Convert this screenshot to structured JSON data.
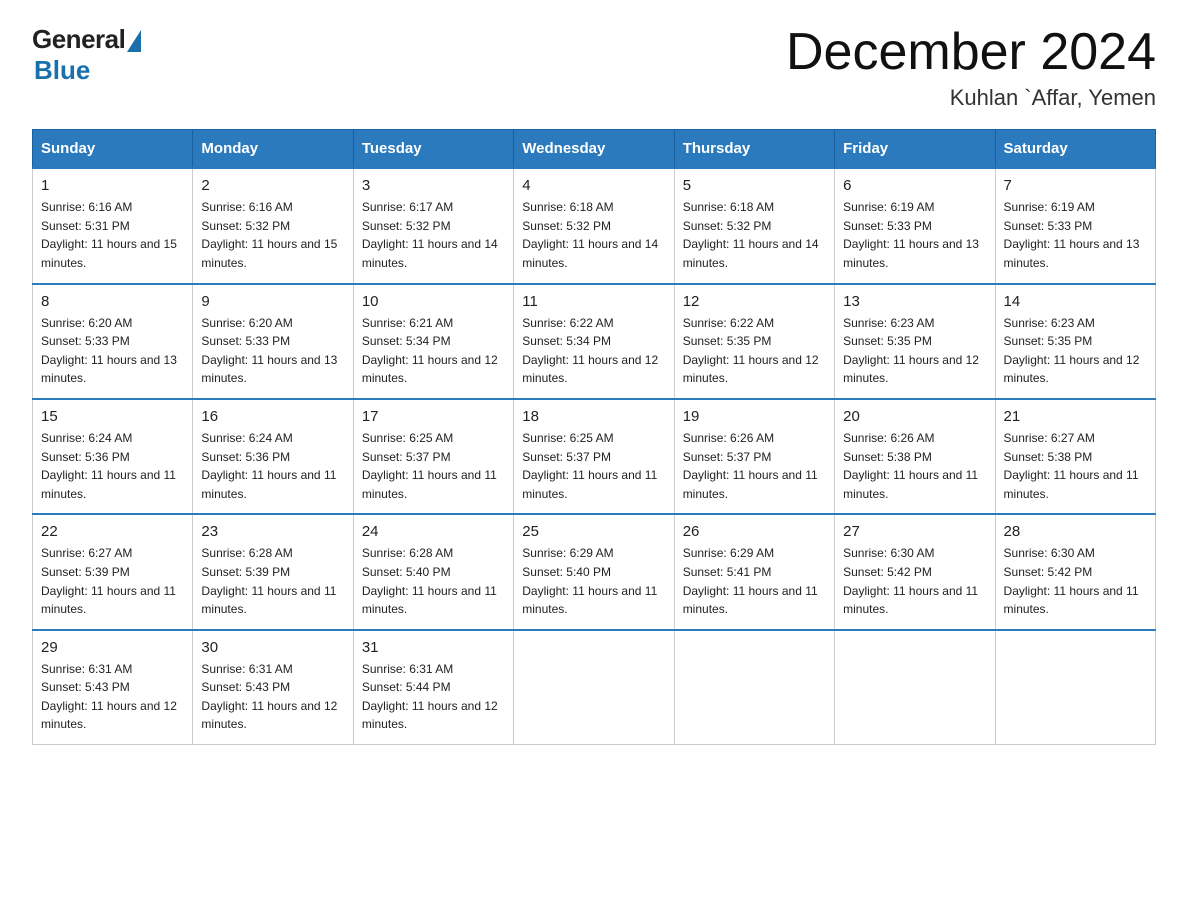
{
  "header": {
    "logo_general": "General",
    "logo_blue": "Blue",
    "month_title": "December 2024",
    "location": "Kuhlan `Affar, Yemen"
  },
  "weekdays": [
    "Sunday",
    "Monday",
    "Tuesday",
    "Wednesday",
    "Thursday",
    "Friday",
    "Saturday"
  ],
  "weeks": [
    [
      {
        "day": "1",
        "sunrise": "6:16 AM",
        "sunset": "5:31 PM",
        "daylight": "11 hours and 15 minutes."
      },
      {
        "day": "2",
        "sunrise": "6:16 AM",
        "sunset": "5:32 PM",
        "daylight": "11 hours and 15 minutes."
      },
      {
        "day": "3",
        "sunrise": "6:17 AM",
        "sunset": "5:32 PM",
        "daylight": "11 hours and 14 minutes."
      },
      {
        "day": "4",
        "sunrise": "6:18 AM",
        "sunset": "5:32 PM",
        "daylight": "11 hours and 14 minutes."
      },
      {
        "day": "5",
        "sunrise": "6:18 AM",
        "sunset": "5:32 PM",
        "daylight": "11 hours and 14 minutes."
      },
      {
        "day": "6",
        "sunrise": "6:19 AM",
        "sunset": "5:33 PM",
        "daylight": "11 hours and 13 minutes."
      },
      {
        "day": "7",
        "sunrise": "6:19 AM",
        "sunset": "5:33 PM",
        "daylight": "11 hours and 13 minutes."
      }
    ],
    [
      {
        "day": "8",
        "sunrise": "6:20 AM",
        "sunset": "5:33 PM",
        "daylight": "11 hours and 13 minutes."
      },
      {
        "day": "9",
        "sunrise": "6:20 AM",
        "sunset": "5:33 PM",
        "daylight": "11 hours and 13 minutes."
      },
      {
        "day": "10",
        "sunrise": "6:21 AM",
        "sunset": "5:34 PM",
        "daylight": "11 hours and 12 minutes."
      },
      {
        "day": "11",
        "sunrise": "6:22 AM",
        "sunset": "5:34 PM",
        "daylight": "11 hours and 12 minutes."
      },
      {
        "day": "12",
        "sunrise": "6:22 AM",
        "sunset": "5:35 PM",
        "daylight": "11 hours and 12 minutes."
      },
      {
        "day": "13",
        "sunrise": "6:23 AM",
        "sunset": "5:35 PM",
        "daylight": "11 hours and 12 minutes."
      },
      {
        "day": "14",
        "sunrise": "6:23 AM",
        "sunset": "5:35 PM",
        "daylight": "11 hours and 12 minutes."
      }
    ],
    [
      {
        "day": "15",
        "sunrise": "6:24 AM",
        "sunset": "5:36 PM",
        "daylight": "11 hours and 11 minutes."
      },
      {
        "day": "16",
        "sunrise": "6:24 AM",
        "sunset": "5:36 PM",
        "daylight": "11 hours and 11 minutes."
      },
      {
        "day": "17",
        "sunrise": "6:25 AM",
        "sunset": "5:37 PM",
        "daylight": "11 hours and 11 minutes."
      },
      {
        "day": "18",
        "sunrise": "6:25 AM",
        "sunset": "5:37 PM",
        "daylight": "11 hours and 11 minutes."
      },
      {
        "day": "19",
        "sunrise": "6:26 AM",
        "sunset": "5:37 PM",
        "daylight": "11 hours and 11 minutes."
      },
      {
        "day": "20",
        "sunrise": "6:26 AM",
        "sunset": "5:38 PM",
        "daylight": "11 hours and 11 minutes."
      },
      {
        "day": "21",
        "sunrise": "6:27 AM",
        "sunset": "5:38 PM",
        "daylight": "11 hours and 11 minutes."
      }
    ],
    [
      {
        "day": "22",
        "sunrise": "6:27 AM",
        "sunset": "5:39 PM",
        "daylight": "11 hours and 11 minutes."
      },
      {
        "day": "23",
        "sunrise": "6:28 AM",
        "sunset": "5:39 PM",
        "daylight": "11 hours and 11 minutes."
      },
      {
        "day": "24",
        "sunrise": "6:28 AM",
        "sunset": "5:40 PM",
        "daylight": "11 hours and 11 minutes."
      },
      {
        "day": "25",
        "sunrise": "6:29 AM",
        "sunset": "5:40 PM",
        "daylight": "11 hours and 11 minutes."
      },
      {
        "day": "26",
        "sunrise": "6:29 AM",
        "sunset": "5:41 PM",
        "daylight": "11 hours and 11 minutes."
      },
      {
        "day": "27",
        "sunrise": "6:30 AM",
        "sunset": "5:42 PM",
        "daylight": "11 hours and 11 minutes."
      },
      {
        "day": "28",
        "sunrise": "6:30 AM",
        "sunset": "5:42 PM",
        "daylight": "11 hours and 11 minutes."
      }
    ],
    [
      {
        "day": "29",
        "sunrise": "6:31 AM",
        "sunset": "5:43 PM",
        "daylight": "11 hours and 12 minutes."
      },
      {
        "day": "30",
        "sunrise": "6:31 AM",
        "sunset": "5:43 PM",
        "daylight": "11 hours and 12 minutes."
      },
      {
        "day": "31",
        "sunrise": "6:31 AM",
        "sunset": "5:44 PM",
        "daylight": "11 hours and 12 minutes."
      },
      null,
      null,
      null,
      null
    ]
  ]
}
